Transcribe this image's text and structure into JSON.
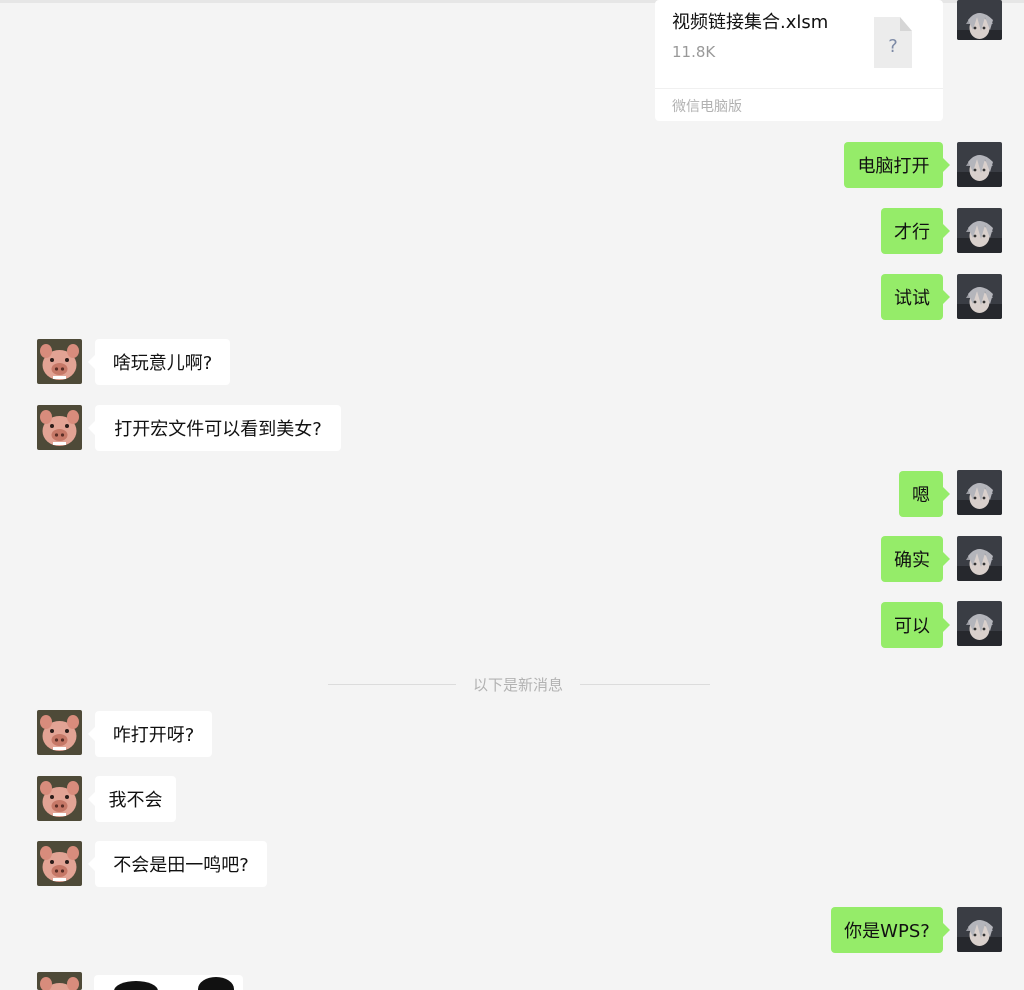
{
  "chat": {
    "file_message": {
      "name": "视频链接集合.xlsm",
      "size": "11.8K",
      "source": "微信电脑版",
      "icon": "file-unknown-icon",
      "icon_glyph": "?"
    },
    "messages": [
      {
        "side": "out",
        "text": "电脑打开"
      },
      {
        "side": "out",
        "text": "才行"
      },
      {
        "side": "out",
        "text": "试试"
      },
      {
        "side": "in",
        "text": "啥玩意儿啊?"
      },
      {
        "side": "in",
        "text": "打开宏文件可以看到美女?"
      },
      {
        "side": "out",
        "text": "嗯"
      },
      {
        "side": "out",
        "text": "确实"
      },
      {
        "side": "out",
        "text": "可以"
      },
      {
        "side": "in",
        "text": "咋打开呀?"
      },
      {
        "side": "in",
        "text": "我不会"
      },
      {
        "side": "in",
        "text": "不会是田一鸣吧?"
      },
      {
        "side": "out",
        "text": "你是WPS?"
      }
    ],
    "new_messages_divider": "以下是新消息",
    "sticker": {
      "icon": "panda-sticker-icon"
    }
  },
  "colors": {
    "background": "#f4f4f4",
    "outgoing_bubble": "#95ec69",
    "incoming_bubble": "#ffffff",
    "meta_text": "#b2b2b2"
  }
}
